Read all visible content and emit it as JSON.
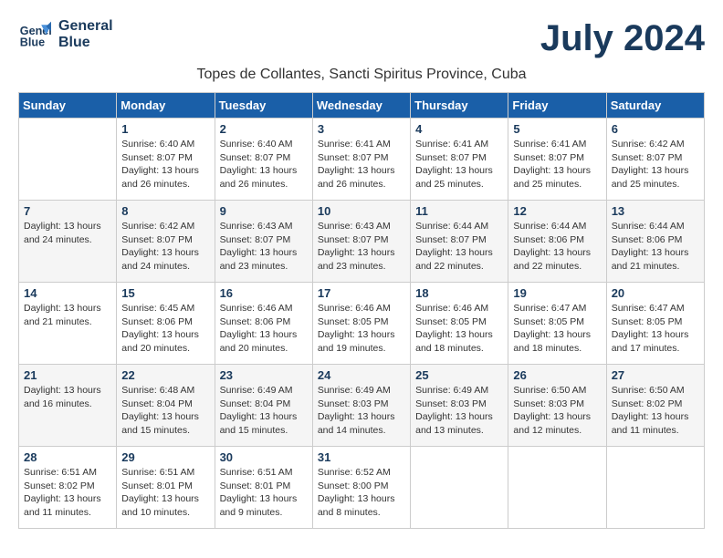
{
  "logo": {
    "text_line1": "General",
    "text_line2": "Blue"
  },
  "title": "July 2024",
  "subtitle": "Topes de Collantes, Sancti Spiritus Province, Cuba",
  "days_of_week": [
    "Sunday",
    "Monday",
    "Tuesday",
    "Wednesday",
    "Thursday",
    "Friday",
    "Saturday"
  ],
  "weeks": [
    [
      {
        "day": "",
        "info": ""
      },
      {
        "day": "1",
        "info": "Sunrise: 6:40 AM\nSunset: 8:07 PM\nDaylight: 13 hours\nand 26 minutes."
      },
      {
        "day": "2",
        "info": "Sunrise: 6:40 AM\nSunset: 8:07 PM\nDaylight: 13 hours\nand 26 minutes."
      },
      {
        "day": "3",
        "info": "Sunrise: 6:41 AM\nSunset: 8:07 PM\nDaylight: 13 hours\nand 26 minutes."
      },
      {
        "day": "4",
        "info": "Sunrise: 6:41 AM\nSunset: 8:07 PM\nDaylight: 13 hours\nand 25 minutes."
      },
      {
        "day": "5",
        "info": "Sunrise: 6:41 AM\nSunset: 8:07 PM\nDaylight: 13 hours\nand 25 minutes."
      },
      {
        "day": "6",
        "info": "Sunrise: 6:42 AM\nSunset: 8:07 PM\nDaylight: 13 hours\nand 25 minutes."
      }
    ],
    [
      {
        "day": "7",
        "info": "Daylight: 13 hours\nand 24 minutes."
      },
      {
        "day": "8",
        "info": "Sunrise: 6:42 AM\nSunset: 8:07 PM\nDaylight: 13 hours\nand 24 minutes."
      },
      {
        "day": "9",
        "info": "Sunrise: 6:43 AM\nSunset: 8:07 PM\nDaylight: 13 hours\nand 23 minutes."
      },
      {
        "day": "10",
        "info": "Sunrise: 6:43 AM\nSunset: 8:07 PM\nDaylight: 13 hours\nand 23 minutes."
      },
      {
        "day": "11",
        "info": "Sunrise: 6:44 AM\nSunset: 8:07 PM\nDaylight: 13 hours\nand 22 minutes."
      },
      {
        "day": "12",
        "info": "Sunrise: 6:44 AM\nSunset: 8:06 PM\nDaylight: 13 hours\nand 22 minutes."
      },
      {
        "day": "13",
        "info": "Sunrise: 6:44 AM\nSunset: 8:06 PM\nDaylight: 13 hours\nand 21 minutes."
      }
    ],
    [
      {
        "day": "14",
        "info": "Daylight: 13 hours\nand 21 minutes."
      },
      {
        "day": "15",
        "info": "Sunrise: 6:45 AM\nSunset: 8:06 PM\nDaylight: 13 hours\nand 20 minutes."
      },
      {
        "day": "16",
        "info": "Sunrise: 6:46 AM\nSunset: 8:06 PM\nDaylight: 13 hours\nand 20 minutes."
      },
      {
        "day": "17",
        "info": "Sunrise: 6:46 AM\nSunset: 8:05 PM\nDaylight: 13 hours\nand 19 minutes."
      },
      {
        "day": "18",
        "info": "Sunrise: 6:46 AM\nSunset: 8:05 PM\nDaylight: 13 hours\nand 18 minutes."
      },
      {
        "day": "19",
        "info": "Sunrise: 6:47 AM\nSunset: 8:05 PM\nDaylight: 13 hours\nand 18 minutes."
      },
      {
        "day": "20",
        "info": "Sunrise: 6:47 AM\nSunset: 8:05 PM\nDaylight: 13 hours\nand 17 minutes."
      }
    ],
    [
      {
        "day": "21",
        "info": "Daylight: 13 hours\nand 16 minutes."
      },
      {
        "day": "22",
        "info": "Sunrise: 6:48 AM\nSunset: 8:04 PM\nDaylight: 13 hours\nand 15 minutes."
      },
      {
        "day": "23",
        "info": "Sunrise: 6:49 AM\nSunset: 8:04 PM\nDaylight: 13 hours\nand 15 minutes."
      },
      {
        "day": "24",
        "info": "Sunrise: 6:49 AM\nSunset: 8:03 PM\nDaylight: 13 hours\nand 14 minutes."
      },
      {
        "day": "25",
        "info": "Sunrise: 6:49 AM\nSunset: 8:03 PM\nDaylight: 13 hours\nand 13 minutes."
      },
      {
        "day": "26",
        "info": "Sunrise: 6:50 AM\nSunset: 8:03 PM\nDaylight: 13 hours\nand 12 minutes."
      },
      {
        "day": "27",
        "info": "Sunrise: 6:50 AM\nSunset: 8:02 PM\nDaylight: 13 hours\nand 11 minutes."
      }
    ],
    [
      {
        "day": "28",
        "info": "Sunrise: 6:51 AM\nSunset: 8:02 PM\nDaylight: 13 hours\nand 11 minutes."
      },
      {
        "day": "29",
        "info": "Sunrise: 6:51 AM\nSunset: 8:01 PM\nDaylight: 13 hours\nand 10 minutes."
      },
      {
        "day": "30",
        "info": "Sunrise: 6:51 AM\nSunset: 8:01 PM\nDaylight: 13 hours\nand 9 minutes."
      },
      {
        "day": "31",
        "info": "Sunrise: 6:52 AM\nSunset: 8:00 PM\nDaylight: 13 hours\nand 8 minutes."
      },
      {
        "day": "",
        "info": ""
      },
      {
        "day": "",
        "info": ""
      },
      {
        "day": "",
        "info": ""
      }
    ]
  ]
}
